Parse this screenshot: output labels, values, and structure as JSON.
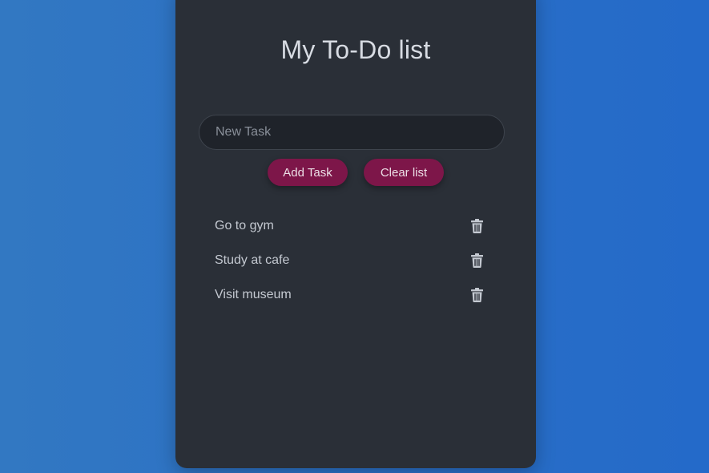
{
  "app": {
    "title": "My To-Do list"
  },
  "input": {
    "placeholder": "New Task",
    "value": ""
  },
  "buttons": {
    "add_label": "Add Task",
    "clear_label": "Clear list"
  },
  "tasks": [
    {
      "label": "Go to gym",
      "icon": "trash-icon"
    },
    {
      "label": "Study at cafe",
      "icon": "trash-icon"
    },
    {
      "label": "Visit museum",
      "icon": "trash-icon"
    }
  ],
  "colors": {
    "background": "#2a6fc6",
    "card": "#2a2f37",
    "button": "#7d1649",
    "text": "#c4c9d1"
  }
}
